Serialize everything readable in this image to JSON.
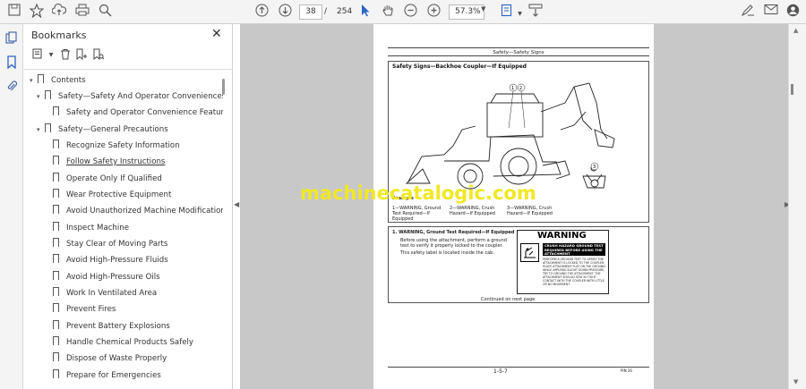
{
  "toolbar": {
    "current_page": "38",
    "page_separator": "/",
    "total_pages": "254",
    "zoom": "57.3%"
  },
  "bookmarks": {
    "title": "Bookmarks",
    "items": [
      {
        "label": "Contents",
        "level": 0,
        "expanded": true
      },
      {
        "label": "Safety—Safety And Operator Conveniences",
        "level": 1,
        "expanded": true
      },
      {
        "label": "Safety and Operator Convenience Features",
        "level": 2
      },
      {
        "label": "Safety—General Precautions",
        "level": 1,
        "expanded": true
      },
      {
        "label": "Recognize Safety Information",
        "level": 2
      },
      {
        "label": "Follow Safety Instructions",
        "level": 2,
        "hovered": true
      },
      {
        "label": "Operate Only If Qualified",
        "level": 2
      },
      {
        "label": "Wear Protective Equipment",
        "level": 2
      },
      {
        "label": "Avoid Unauthorized Machine Modifications",
        "level": 2
      },
      {
        "label": "Inspect Machine",
        "level": 2
      },
      {
        "label": "Stay Clear of Moving Parts",
        "level": 2
      },
      {
        "label": "Avoid High-Pressure Fluids",
        "level": 2
      },
      {
        "label": "Avoid High-Pressure Oils",
        "level": 2
      },
      {
        "label": "Work In Ventilated Area",
        "level": 2
      },
      {
        "label": "Prevent Fires",
        "level": 2
      },
      {
        "label": "Prevent Battery Explosions",
        "level": 2
      },
      {
        "label": "Handle Chemical Products Safely",
        "level": 2
      },
      {
        "label": "Dispose of Waste Properly",
        "level": 2
      },
      {
        "label": "Prepare for Emergencies",
        "level": 2
      }
    ]
  },
  "document": {
    "header": "Safety—Safety Signs",
    "section_title": "Safety Signs—Backhoe Coupler—If Equipped",
    "example_label": "Example",
    "callout_1": "1—WARNING, Ground Test Required—If Equipped",
    "callout_2": "2—WARNING, Crush Hazard—If Equipped",
    "callout_3": "3—WARNING, Crush Hazard—If Equipped",
    "item_title": "1.   WARNING, Ground Test Required—If Equipped",
    "item_text_1": "Before using the attachment, perform a ground test to verify it properly locked to the coupler.",
    "item_text_2": "This safety label is located inside the cab.",
    "continued": "Continued on next page",
    "warning_heading": "WARNING",
    "warning_sub": "CRUSH HAZARD GROUND TEST REQUIRED BEFORE USING THE ATTACHMENT",
    "warning_body": "PERFORM A GROUND TEST TO VERIFY THE ATTACHMENT IS LOCKED TO THE COUPLER. PLACE ATTACHMENT FLAT ON THE GROUND. WHILE APPLYING SLIGHT DOWN PRESSURE, TRY TO GROUND THE ATTACHMENT. THE ATTACHMENT SHOULD STAY IN TIGHT CONTACT WITH THE COUPLER WITH LITTLE OR NO MOVEMENT.",
    "page_number": "1-5-7",
    "footer_code": "PIN 26",
    "watermark": "machinecatalogic.com"
  },
  "colors": {
    "watermark": "#f1e826",
    "viewer_bg": "#c8c8c8",
    "accent": "#3a5ea6"
  }
}
